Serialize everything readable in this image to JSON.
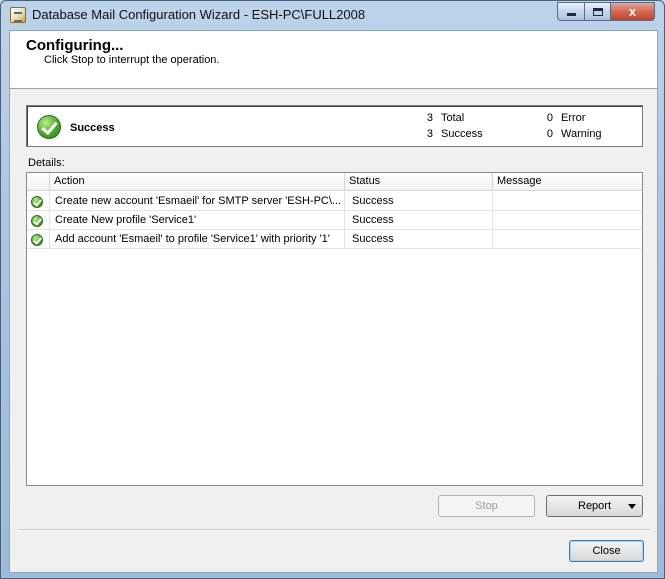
{
  "window": {
    "title": "Database Mail Configuration Wizard - ESH-PC\\FULL2008",
    "controls": {
      "minimize": "minimize",
      "maximize": "maximize",
      "close": "x"
    }
  },
  "header": {
    "title": "Configuring...",
    "subtitle": "Click Stop to interrupt the operation."
  },
  "summary": {
    "status": "Success",
    "total_count": "3",
    "total_label": "Total",
    "success_count": "3",
    "success_label": "Success",
    "error_count": "0",
    "error_label": "Error",
    "warning_count": "0",
    "warning_label": "Warning"
  },
  "details": {
    "label": "Details:",
    "columns": [
      "Action",
      "Status",
      "Message"
    ],
    "rows": [
      {
        "action": "Create new account 'Esmaeil' for SMTP server 'ESH-PC\\...",
        "status": "Success",
        "message": ""
      },
      {
        "action": "Create New profile 'Service1'",
        "status": "Success",
        "message": ""
      },
      {
        "action": "Add account 'Esmaeil' to profile 'Service1' with priority '1'",
        "status": "Success",
        "message": ""
      }
    ]
  },
  "buttons": {
    "stop": "Stop",
    "report": "Report",
    "close": "Close"
  },
  "colors": {
    "success_green": "#3f9e22",
    "title_bar": "#a9c6e2",
    "close_button": "#c0452a"
  }
}
